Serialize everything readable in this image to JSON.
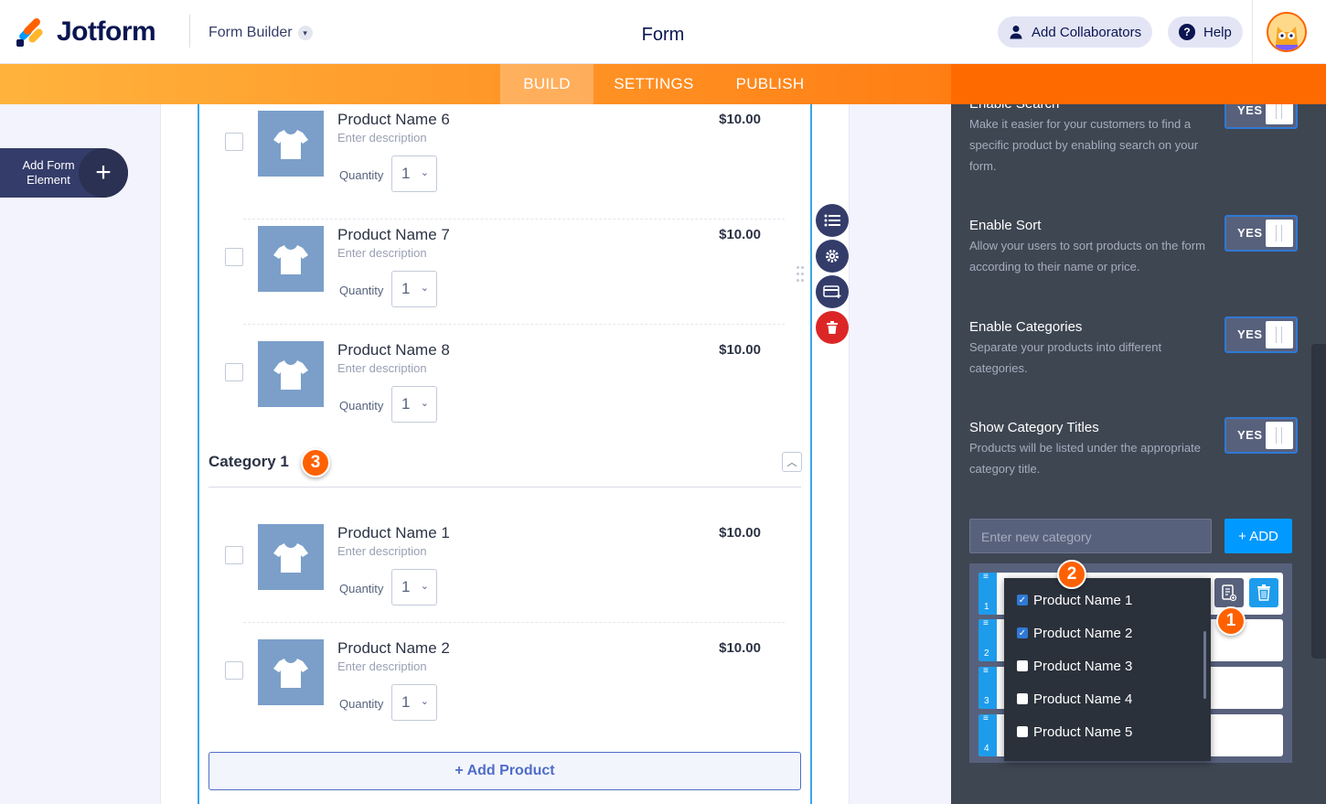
{
  "header": {
    "logo_text": "Jotform",
    "builder_label": "Form Builder",
    "form_title": "Form",
    "collaborators_label": "Add Collaborators",
    "help_label": "Help",
    "help_icon_text": "?"
  },
  "tabs": [
    {
      "label": "BUILD",
      "active": true
    },
    {
      "label": "SETTINGS",
      "active": false
    },
    {
      "label": "PUBLISH",
      "active": false
    }
  ],
  "add_element": {
    "label": "Add Form Element",
    "plus": "+"
  },
  "products_top": [
    {
      "name": "Product Name 6",
      "description": "Enter description",
      "price": "$10.00",
      "quantity_label": "Quantity",
      "quantity": "1"
    },
    {
      "name": "Product Name 7",
      "description": "Enter description",
      "price": "$10.00",
      "quantity_label": "Quantity",
      "quantity": "1"
    },
    {
      "name": "Product Name 8",
      "description": "Enter description",
      "price": "$10.00",
      "quantity_label": "Quantity",
      "quantity": "1"
    }
  ],
  "category": {
    "title": "Category 1",
    "badge": "3"
  },
  "products_category": [
    {
      "name": "Product Name 1",
      "description": "Enter description",
      "price": "$10.00",
      "quantity_label": "Quantity",
      "quantity": "1"
    },
    {
      "name": "Product Name 2",
      "description": "Enter description",
      "price": "$10.00",
      "quantity_label": "Quantity",
      "quantity": "1"
    }
  ],
  "add_product_label": "+ Add Product",
  "settings": {
    "search": {
      "title": "Enable Search",
      "description": "Make it easier for your customers to find a specific product by enabling search on your form.",
      "toggle": "YES"
    },
    "sort": {
      "title": "Enable Sort",
      "description": "Allow your users to sort products on the form according to their name or price.",
      "toggle": "YES"
    },
    "categories": {
      "title": "Enable Categories",
      "description": "Separate your products into different categories.",
      "toggle": "YES"
    },
    "category_titles": {
      "title": "Show Category Titles",
      "description": "Products will be listed under the appropriate category title.",
      "toggle": "YES"
    }
  },
  "category_input": {
    "placeholder": "Enter new category",
    "add_label": "+ ADD"
  },
  "category_rows": [
    "1",
    "2",
    "3",
    "4"
  ],
  "badges": {
    "one": "1",
    "two": "2"
  },
  "dropdown_items": [
    {
      "label": "Product Name 1",
      "checked": true
    },
    {
      "label": "Product Name 2",
      "checked": true
    },
    {
      "label": "Product Name 3",
      "checked": false
    },
    {
      "label": "Product Name 4",
      "checked": false
    },
    {
      "label": "Product Name 5",
      "checked": false
    }
  ],
  "colors": {
    "accent_orange": "#ff6100",
    "primary_blue": "#0099ff",
    "navy": "#0a1551",
    "delete_red": "#dc2626"
  }
}
